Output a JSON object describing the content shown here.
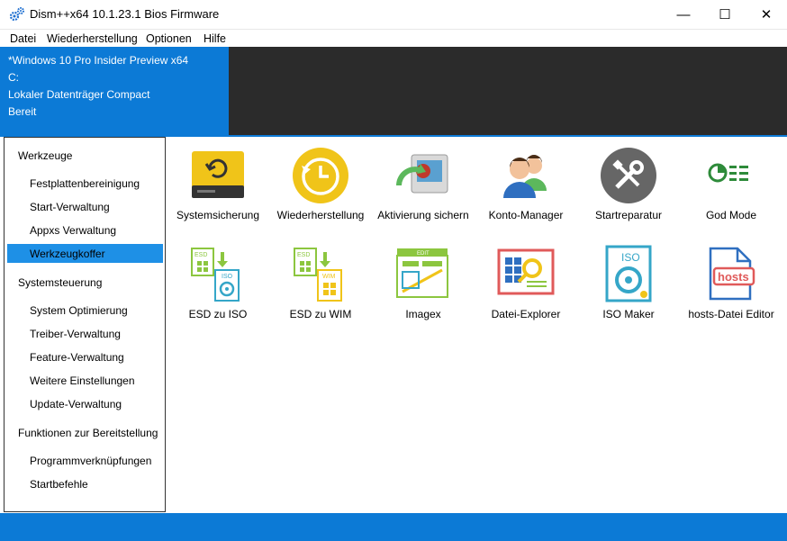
{
  "window": {
    "title": "Dism++x64 10.1.23.1 Bios Firmware",
    "minimize": "—",
    "maximize": "☐",
    "close": "✕"
  },
  "menu": [
    "Datei",
    "Wiederherstellung",
    "Optionen",
    "Hilfe"
  ],
  "status": {
    "os": "*Windows 10 Pro Insider Preview x64",
    "drive": "C:",
    "volume": "Lokaler Datenträger Compact",
    "state": "Bereit"
  },
  "sidebar": {
    "sections": [
      {
        "title": "Werkzeuge",
        "items": [
          "Festplattenbereinigung",
          "Start-Verwaltung",
          "Appxs Verwaltung",
          "Werkzeugkoffer"
        ]
      },
      {
        "title": "Systemsteuerung",
        "items": [
          "System Optimierung",
          "Treiber-Verwaltung",
          "Feature-Verwaltung",
          "Weitere Einstellungen",
          "Update-Verwaltung"
        ]
      },
      {
        "title": "Funktionen zur Bereitstellung",
        "items": [
          "Programmverknüpfungen",
          "Startbefehle"
        ]
      }
    ],
    "selected": "Werkzeugkoffer"
  },
  "tools": [
    {
      "label": "Systemsicherung",
      "icon": "backup-drive-icon"
    },
    {
      "label": "Wiederherstellung",
      "icon": "restore-clock-icon"
    },
    {
      "label": "Aktivierung sichern",
      "icon": "activation-backup-icon"
    },
    {
      "label": "Konto-Manager",
      "icon": "users-icon"
    },
    {
      "label": "Startreparatur",
      "icon": "repair-tools-icon"
    },
    {
      "label": "God Mode",
      "icon": "god-mode-icon"
    },
    {
      "label": "ESD zu ISO",
      "icon": "esd-to-iso-icon"
    },
    {
      "label": "ESD zu WIM",
      "icon": "esd-to-wim-icon"
    },
    {
      "label": "Imagex",
      "icon": "imagex-icon"
    },
    {
      "label": "Datei-Explorer",
      "icon": "file-explorer-icon"
    },
    {
      "label": "ISO Maker",
      "icon": "iso-maker-icon"
    },
    {
      "label": "hosts-Datei Editor",
      "icon": "hosts-editor-icon"
    }
  ],
  "icon_text": {
    "esd": "ESD",
    "iso": "ISO",
    "wim": "WIM",
    "hosts": "hosts",
    "edit": "EDIT"
  },
  "colors": {
    "accent": "#0c7ad6",
    "selection": "#1e90e6",
    "dark": "#2b2b2b"
  }
}
